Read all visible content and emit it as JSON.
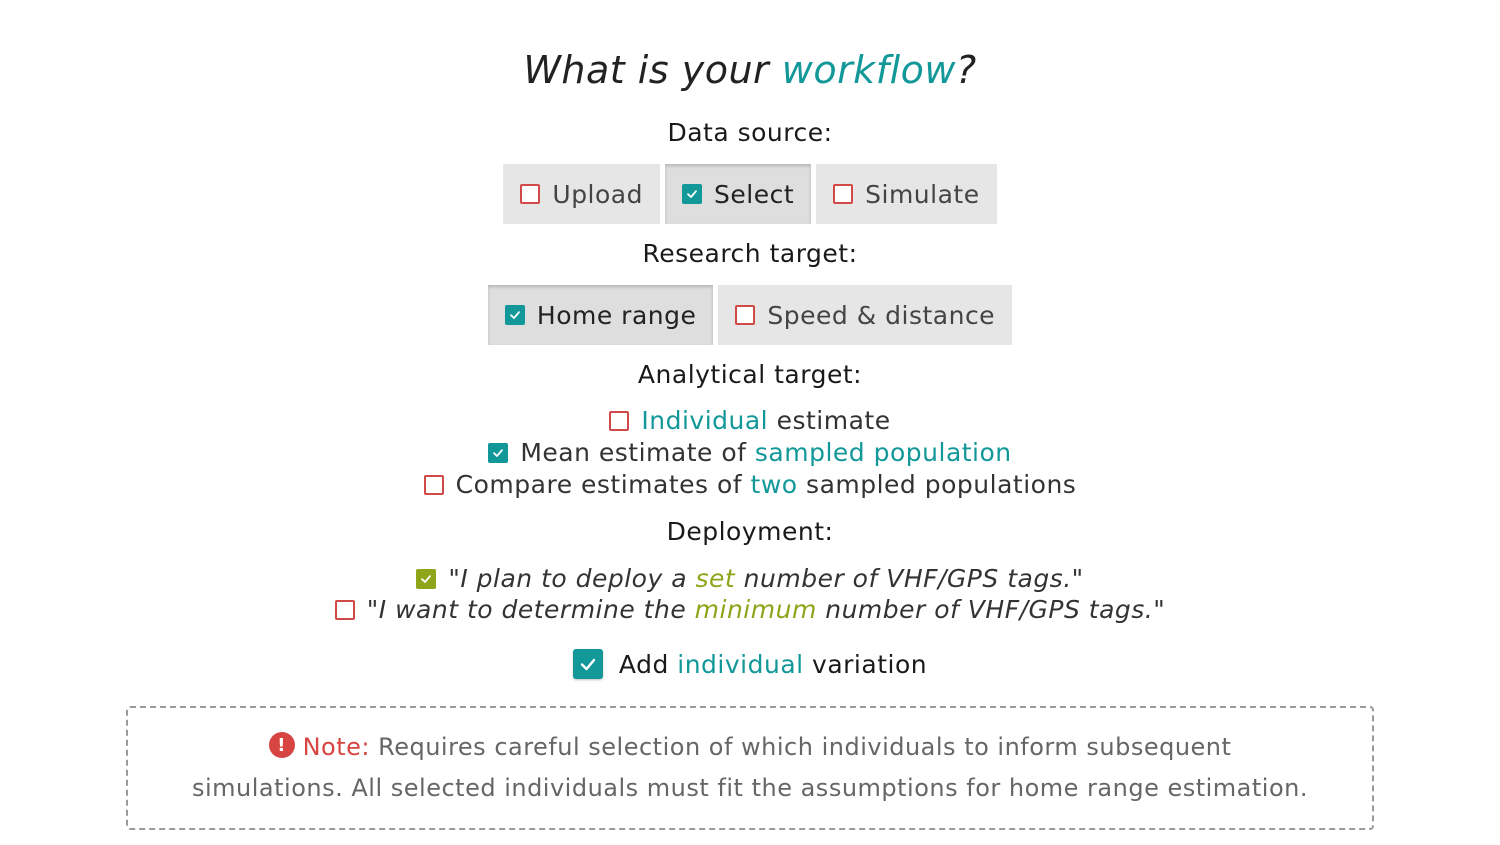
{
  "colors": {
    "teal": "#13989a",
    "olive": "#8ea51a",
    "danger": "#d24a47"
  },
  "title": {
    "prefix": "What is your ",
    "accent": "workflow",
    "suffix": "?"
  },
  "data_source": {
    "label": "Data source:",
    "options": [
      {
        "label": "Upload",
        "checked": false
      },
      {
        "label": "Select",
        "checked": true
      },
      {
        "label": "Simulate",
        "checked": false
      }
    ]
  },
  "research_target": {
    "label": "Research target:",
    "options": [
      {
        "label": "Home range",
        "checked": true
      },
      {
        "label": "Speed & distance",
        "checked": false
      }
    ]
  },
  "analytical_target": {
    "label": "Analytical target:",
    "options": [
      {
        "pre": "",
        "accent": "Individual",
        "post": " estimate",
        "checked": false
      },
      {
        "pre": "Mean estimate of ",
        "accent": "sampled population",
        "post": "",
        "checked": true
      },
      {
        "pre": "Compare estimates of ",
        "accent": "two",
        "post": " sampled populations",
        "checked": false
      }
    ]
  },
  "deployment": {
    "label": "Deployment:",
    "options": [
      {
        "pre": "\"I plan to deploy a ",
        "accent": "set",
        "post": " number of VHF/GPS tags.\"",
        "checked": true
      },
      {
        "pre": "\"I want to determine the ",
        "accent": "minimum",
        "post": " number of VHF/GPS tags.\"",
        "checked": false
      }
    ]
  },
  "variation": {
    "pre": "Add ",
    "accent": "individual",
    "post": " variation",
    "checked": true
  },
  "note": {
    "icon": "exclamation-icon",
    "icon_glyph": "!",
    "label": "Note:",
    "text": " Requires careful selection of which individuals to inform subsequent simulations. All selected individuals must fit the assumptions for home range estimation."
  }
}
